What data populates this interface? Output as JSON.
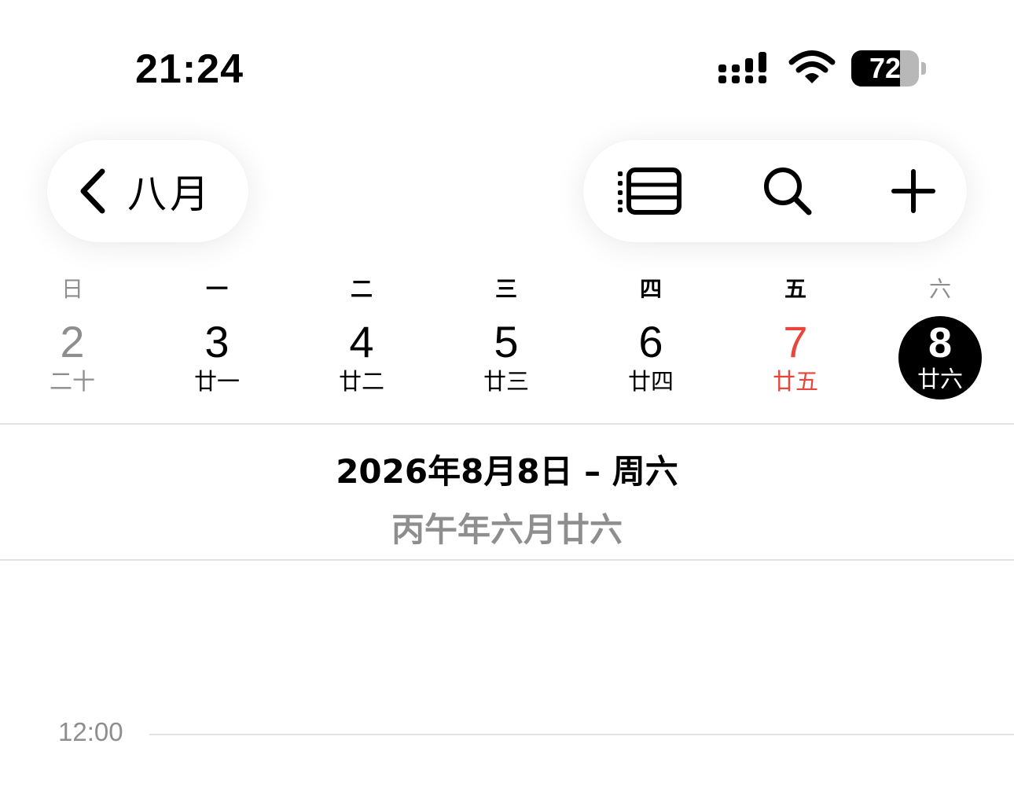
{
  "status_bar": {
    "time": "21:24",
    "battery_percent": "72",
    "battery_level": 0.72,
    "icons": [
      "signal-icon",
      "wifi-icon",
      "battery-icon"
    ]
  },
  "nav": {
    "back_label": "八月",
    "back_icon": "chevron-left-icon",
    "actions": [
      "list-view-icon",
      "search-icon",
      "plus-icon"
    ]
  },
  "weekdays": [
    "日",
    "一",
    "二",
    "三",
    "四",
    "五",
    "六"
  ],
  "days": [
    {
      "num": "2",
      "lunar": "二十"
    },
    {
      "num": "3",
      "lunar": "廿一"
    },
    {
      "num": "4",
      "lunar": "廿二"
    },
    {
      "num": "5",
      "lunar": "廿三"
    },
    {
      "num": "6",
      "lunar": "廿四"
    },
    {
      "num": "7",
      "lunar": "廿五"
    },
    {
      "num": "8",
      "lunar": "廿六"
    }
  ],
  "selected_date": {
    "title": "2026年8月8日 – 周六",
    "lunar": "丙午年六月廿六"
  },
  "timeline": {
    "time_label": "12:00"
  },
  "colors": {
    "today_red": "#e8453c",
    "secondary_gray": "#8e8e8e",
    "selected_bg": "#000000"
  }
}
